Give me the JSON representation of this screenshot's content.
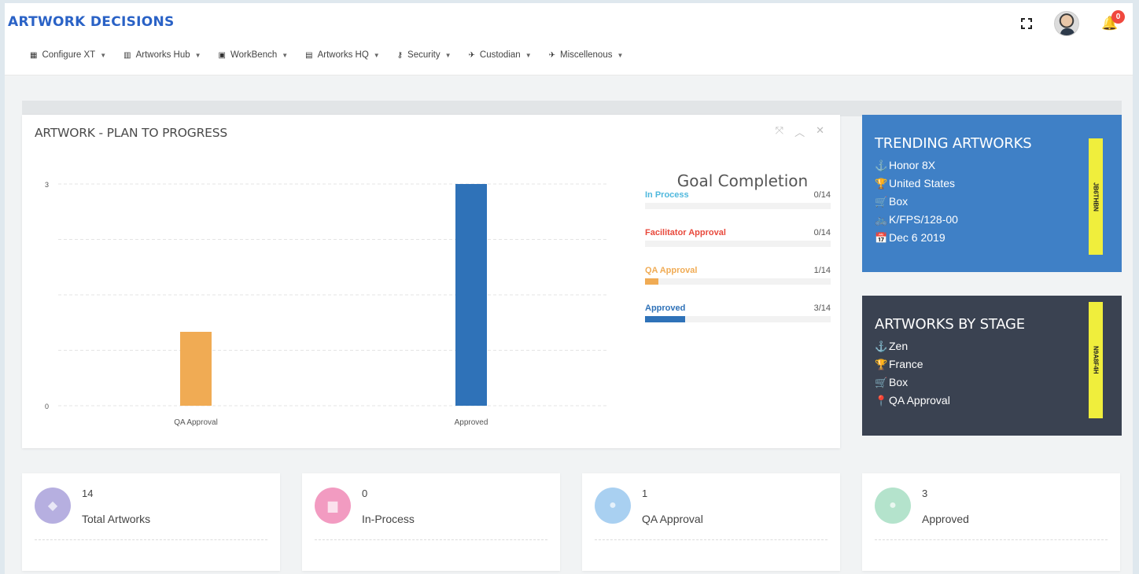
{
  "header": {
    "brand": "ARTWORK DECISIONS",
    "notification_count": "0"
  },
  "nav": [
    {
      "label": "Configure XT",
      "icon": "grid-icon"
    },
    {
      "label": "Artworks Hub",
      "icon": "bars-icon"
    },
    {
      "label": "WorkBench",
      "icon": "bus-icon"
    },
    {
      "label": "Artworks HQ",
      "icon": "book-icon"
    },
    {
      "label": "Security",
      "icon": "key-icon"
    },
    {
      "label": "Custodian",
      "icon": "plane-icon"
    },
    {
      "label": "Miscellenous",
      "icon": "plane-icon"
    }
  ],
  "panel": {
    "title": "ARTWORK - PLAN TO PROGRESS"
  },
  "chart_data": {
    "type": "bar",
    "categories": [
      "QA Approval",
      "Approved"
    ],
    "values": [
      1,
      3
    ],
    "colors": [
      "#f0ab54",
      "#2f72b8"
    ],
    "ylim": [
      0,
      3
    ],
    "yticks": [
      0,
      3
    ],
    "grid": true
  },
  "goal": {
    "title": "Goal Completion",
    "items": [
      {
        "label": "In Process",
        "value": "0/14",
        "fraction": 0.0,
        "color": "#4fb8dd"
      },
      {
        "label": "Facilitator Approval",
        "value": "0/14",
        "fraction": 0.0,
        "color": "#e8493c"
      },
      {
        "label": "QA Approval",
        "value": "1/14",
        "fraction": 0.0714,
        "color": "#f0ab54"
      },
      {
        "label": "Approved",
        "value": "3/14",
        "fraction": 0.2143,
        "color": "#2f72b8"
      }
    ]
  },
  "trending": {
    "title": "TRENDING ARTWORKS",
    "tag": "JB6THBN",
    "rows": [
      {
        "icon": "anchor-icon",
        "glyph": "⚓",
        "text": "Honor 8X"
      },
      {
        "icon": "trophy-icon",
        "glyph": "🏆",
        "text": "United States"
      },
      {
        "icon": "cart-icon",
        "glyph": "🛒",
        "text": "Box"
      },
      {
        "icon": "bicycle-icon",
        "glyph": "🚲",
        "text": "K/FPS/128-00"
      },
      {
        "icon": "calendar-icon",
        "glyph": "📅",
        "text": "Dec 6 2019"
      }
    ]
  },
  "by_stage": {
    "title": "ARTWORKS BY STAGE",
    "tag": "N9A8F4H",
    "rows": [
      {
        "icon": "anchor-icon",
        "glyph": "⚓",
        "text": "Zen"
      },
      {
        "icon": "trophy-icon",
        "glyph": "🏆",
        "text": "France"
      },
      {
        "icon": "cart-icon",
        "glyph": "🛒",
        "text": "Box"
      },
      {
        "icon": "map-marker-icon",
        "glyph": "📍",
        "text": "QA Approval"
      }
    ]
  },
  "stats": [
    {
      "value": "14",
      "label": "Total Artworks",
      "color": "#b6afe0",
      "icon": "layers-icon"
    },
    {
      "value": "0",
      "label": "In-Process",
      "color": "#f29bc1",
      "icon": "briefcase-icon"
    },
    {
      "value": "1",
      "label": "QA Approval",
      "color": "#a9d0f1",
      "icon": "user-icon"
    },
    {
      "value": "3",
      "label": "Approved",
      "color": "#b4e3cc",
      "icon": "user-icon"
    }
  ]
}
